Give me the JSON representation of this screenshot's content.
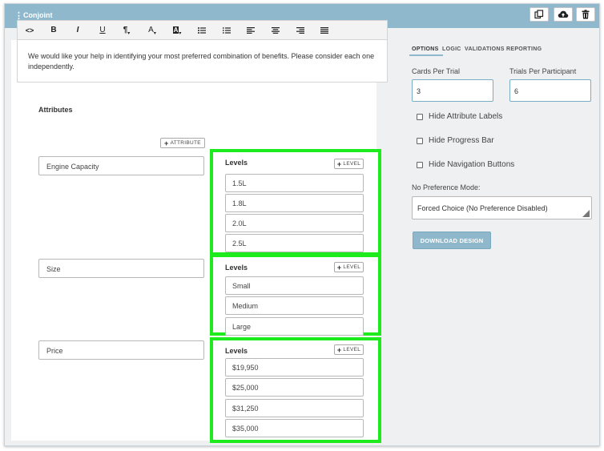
{
  "window": {
    "title": "Conjoint",
    "drag_handle": "⋮",
    "colors": {
      "header": "#8fb8cc",
      "highlight": "#1eeb1e"
    }
  },
  "header_buttons": [
    {
      "icon": "duplicate-icon"
    },
    {
      "icon": "cloud-upload-icon"
    },
    {
      "icon": "trash-icon"
    }
  ],
  "toolbar": {
    "code": "<>",
    "bold": "B",
    "italic": "I",
    "underline": "U",
    "paragraph": "¶",
    "font_color": "A",
    "bg_color": "A"
  },
  "editor": {
    "text": "We would like your help in identifying your most preferred combination of benefits. Please consider each one independently."
  },
  "attributes": {
    "label": "Attributes",
    "add_button": "ATTRIBUTE",
    "levels_label": "Levels",
    "add_level_button": "LEVEL",
    "items": [
      {
        "name": "Engine Capacity",
        "levels": [
          "1.5L",
          "1.8L",
          "2.0L",
          "2.5L"
        ]
      },
      {
        "name": "Size",
        "levels": [
          "Small",
          "Medium",
          "Large"
        ]
      },
      {
        "name": "Price",
        "levels": [
          "$19,950",
          "$25,000",
          "$31,250",
          "$35,000"
        ]
      }
    ]
  },
  "tabs": [
    "OPTIONS",
    "LOGIC",
    "VALIDATIONS",
    "REPORTING"
  ],
  "options": {
    "cards_per_trial_label": "Cards Per Trial",
    "cards_per_trial_value": "3",
    "trials_per_participant_label": "Trials Per Participant",
    "trials_per_participant_value": "6",
    "hide_attribute_labels": "Hide Attribute Labels",
    "hide_progress_bar": "Hide Progress Bar",
    "hide_navigation_buttons": "Hide Navigation Buttons",
    "no_preference_label": "No Preference Mode:",
    "no_preference_value": "Forced Choice (No Preference Disabled)",
    "download_button": "DOWNLOAD DESIGN"
  }
}
